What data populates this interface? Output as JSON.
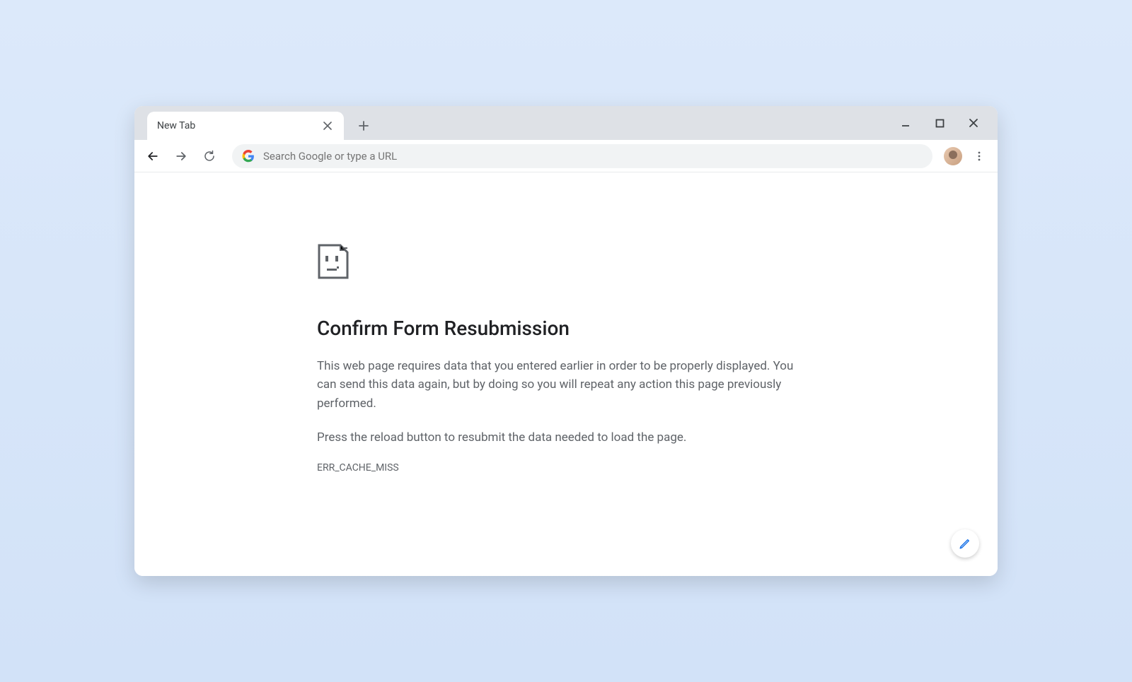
{
  "tab": {
    "title": "New Tab"
  },
  "omnibox": {
    "placeholder": "Search Google or type a URL"
  },
  "error": {
    "title": "Confirm Form Resubmission",
    "p1": "This web page requires data that you entered earlier in order to be properly displayed. You can send this data again, but by doing so you will repeat any action this page previously performed.",
    "p2": "Press the reload button to resubmit the data needed to load the page.",
    "code": "ERR_CACHE_MISS"
  }
}
